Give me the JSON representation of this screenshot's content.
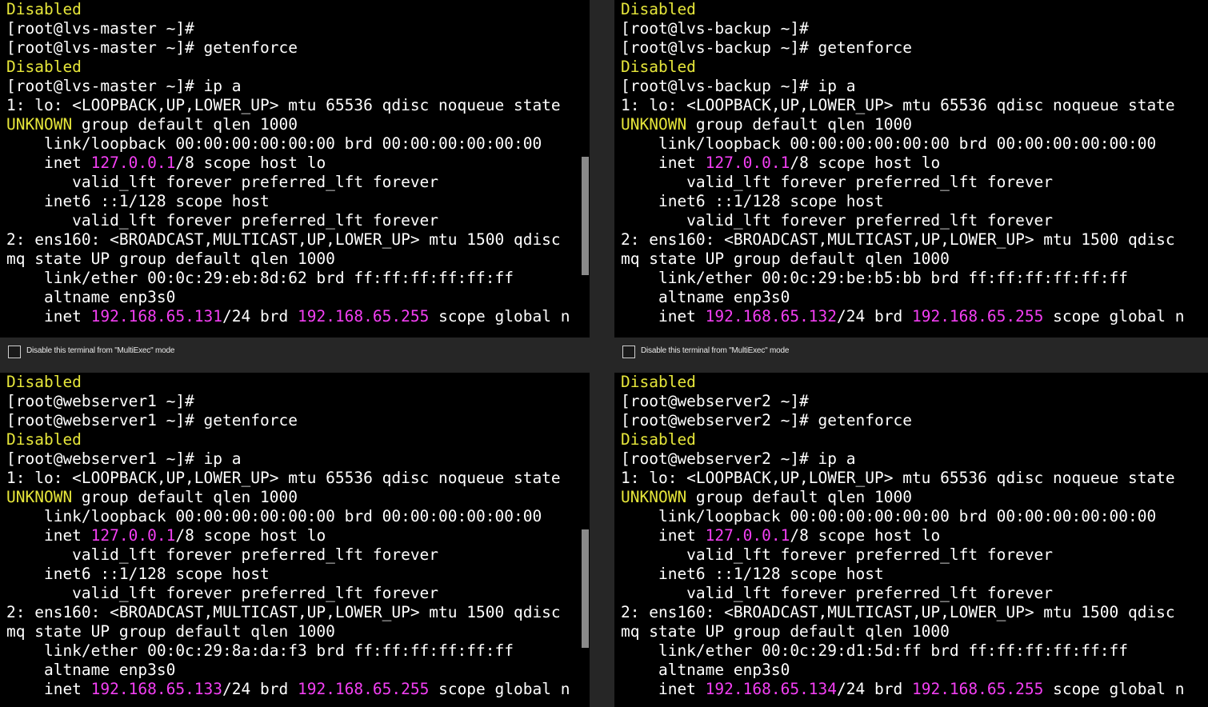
{
  "multiexec_label": "Disable this terminal from \"MultiExec\" mode",
  "colors": {
    "background": "#000000",
    "text": "#ffffff",
    "highlight_yellow": "#e6e63a",
    "highlight_magenta": "#f33ff3"
  },
  "panes": [
    {
      "lines": [
        [
          {
            "t": "Disabled",
            "c": "y"
          }
        ],
        [
          {
            "t": "[root@lvs-master ~]#"
          }
        ],
        [
          {
            "t": "[root@lvs-master ~]# getenforce"
          }
        ],
        [
          {
            "t": "Disabled",
            "c": "y"
          }
        ],
        [
          {
            "t": "[root@lvs-master ~]# ip a"
          }
        ],
        [
          {
            "t": "1: lo: <LOOPBACK,UP,LOWER_UP> mtu 65536 qdisc noqueue state"
          }
        ],
        [
          {
            "t": "UNKNOWN",
            "c": "y"
          },
          {
            "t": " group default qlen 1000"
          }
        ],
        [
          {
            "t": "    link/loopback 00:00:00:00:00:00 brd 00:00:00:00:00:00"
          }
        ],
        [
          {
            "t": "    inet "
          },
          {
            "t": "127.0.0.1",
            "c": "m"
          },
          {
            "t": "/8 scope host lo"
          }
        ],
        [
          {
            "t": "       valid_lft forever preferred_lft forever"
          }
        ],
        [
          {
            "t": "    inet6 ::1/128 scope host"
          }
        ],
        [
          {
            "t": "       valid_lft forever preferred_lft forever"
          }
        ],
        [
          {
            "t": "2: ens160: <BROADCAST,MULTICAST,UP,LOWER_UP> mtu 1500 qdisc"
          }
        ],
        [
          {
            "t": "mq state UP group default qlen 1000"
          }
        ],
        [
          {
            "t": "    link/ether 00:0c:29:eb:8d:62 brd ff:ff:ff:ff:ff:ff"
          }
        ],
        [
          {
            "t": "    altname enp3s0"
          }
        ],
        [
          {
            "t": "    inet "
          },
          {
            "t": "192.168.65.131",
            "c": "m"
          },
          {
            "t": "/24 brd "
          },
          {
            "t": "192.168.65.255",
            "c": "m"
          },
          {
            "t": " scope global n"
          }
        ]
      ]
    },
    {
      "lines": [
        [
          {
            "t": "Disabled",
            "c": "y"
          }
        ],
        [
          {
            "t": "[root@lvs-backup ~]#"
          }
        ],
        [
          {
            "t": "[root@lvs-backup ~]# getenforce"
          }
        ],
        [
          {
            "t": "Disabled",
            "c": "y"
          }
        ],
        [
          {
            "t": "[root@lvs-backup ~]# ip a"
          }
        ],
        [
          {
            "t": "1: lo: <LOOPBACK,UP,LOWER_UP> mtu 65536 qdisc noqueue state"
          }
        ],
        [
          {
            "t": "UNKNOWN",
            "c": "y"
          },
          {
            "t": " group default qlen 1000"
          }
        ],
        [
          {
            "t": "    link/loopback 00:00:00:00:00:00 brd 00:00:00:00:00:00"
          }
        ],
        [
          {
            "t": "    inet "
          },
          {
            "t": "127.0.0.1",
            "c": "m"
          },
          {
            "t": "/8 scope host lo"
          }
        ],
        [
          {
            "t": "       valid_lft forever preferred_lft forever"
          }
        ],
        [
          {
            "t": "    inet6 ::1/128 scope host"
          }
        ],
        [
          {
            "t": "       valid_lft forever preferred_lft forever"
          }
        ],
        [
          {
            "t": "2: ens160: <BROADCAST,MULTICAST,UP,LOWER_UP> mtu 1500 qdisc"
          }
        ],
        [
          {
            "t": "mq state UP group default qlen 1000"
          }
        ],
        [
          {
            "t": "    link/ether 00:0c:29:be:b5:bb brd ff:ff:ff:ff:ff:ff"
          }
        ],
        [
          {
            "t": "    altname enp3s0"
          }
        ],
        [
          {
            "t": "    inet "
          },
          {
            "t": "192.168.65.132",
            "c": "m"
          },
          {
            "t": "/24 brd "
          },
          {
            "t": "192.168.65.255",
            "c": "m"
          },
          {
            "t": " scope global n"
          }
        ]
      ]
    },
    {
      "lines": [
        [
          {
            "t": "Disabled",
            "c": "y"
          }
        ],
        [
          {
            "t": "[root@webserver1 ~]#"
          }
        ],
        [
          {
            "t": "[root@webserver1 ~]# getenforce"
          }
        ],
        [
          {
            "t": "Disabled",
            "c": "y"
          }
        ],
        [
          {
            "t": "[root@webserver1 ~]# ip a"
          }
        ],
        [
          {
            "t": "1: lo: <LOOPBACK,UP,LOWER_UP> mtu 65536 qdisc noqueue state"
          }
        ],
        [
          {
            "t": "UNKNOWN",
            "c": "y"
          },
          {
            "t": " group default qlen 1000"
          }
        ],
        [
          {
            "t": "    link/loopback 00:00:00:00:00:00 brd 00:00:00:00:00:00"
          }
        ],
        [
          {
            "t": "    inet "
          },
          {
            "t": "127.0.0.1",
            "c": "m"
          },
          {
            "t": "/8 scope host lo"
          }
        ],
        [
          {
            "t": "       valid_lft forever preferred_lft forever"
          }
        ],
        [
          {
            "t": "    inet6 ::1/128 scope host"
          }
        ],
        [
          {
            "t": "       valid_lft forever preferred_lft forever"
          }
        ],
        [
          {
            "t": "2: ens160: <BROADCAST,MULTICAST,UP,LOWER_UP> mtu 1500 qdisc"
          }
        ],
        [
          {
            "t": "mq state UP group default qlen 1000"
          }
        ],
        [
          {
            "t": "    link/ether 00:0c:29:8a:da:f3 brd ff:ff:ff:ff:ff:ff"
          }
        ],
        [
          {
            "t": "    altname enp3s0"
          }
        ],
        [
          {
            "t": "    inet "
          },
          {
            "t": "192.168.65.133",
            "c": "m"
          },
          {
            "t": "/24 brd "
          },
          {
            "t": "192.168.65.255",
            "c": "m"
          },
          {
            "t": " scope global n"
          }
        ]
      ]
    },
    {
      "lines": [
        [
          {
            "t": "Disabled",
            "c": "y"
          }
        ],
        [
          {
            "t": "[root@webserver2 ~]#"
          }
        ],
        [
          {
            "t": "[root@webserver2 ~]# getenforce"
          }
        ],
        [
          {
            "t": "Disabled",
            "c": "y"
          }
        ],
        [
          {
            "t": "[root@webserver2 ~]# ip a"
          }
        ],
        [
          {
            "t": "1: lo: <LOOPBACK,UP,LOWER_UP> mtu 65536 qdisc noqueue state"
          }
        ],
        [
          {
            "t": "UNKNOWN",
            "c": "y"
          },
          {
            "t": " group default qlen 1000"
          }
        ],
        [
          {
            "t": "    link/loopback 00:00:00:00:00:00 brd 00:00:00:00:00:00"
          }
        ],
        [
          {
            "t": "    inet "
          },
          {
            "t": "127.0.0.1",
            "c": "m"
          },
          {
            "t": "/8 scope host lo"
          }
        ],
        [
          {
            "t": "       valid_lft forever preferred_lft forever"
          }
        ],
        [
          {
            "t": "    inet6 ::1/128 scope host"
          }
        ],
        [
          {
            "t": "       valid_lft forever preferred_lft forever"
          }
        ],
        [
          {
            "t": "2: ens160: <BROADCAST,MULTICAST,UP,LOWER_UP> mtu 1500 qdisc"
          }
        ],
        [
          {
            "t": "mq state UP group default qlen 1000"
          }
        ],
        [
          {
            "t": "    link/ether 00:0c:29:d1:5d:ff brd ff:ff:ff:ff:ff:ff"
          }
        ],
        [
          {
            "t": "    altname enp3s0"
          }
        ],
        [
          {
            "t": "    inet "
          },
          {
            "t": "192.168.65.134",
            "c": "m"
          },
          {
            "t": "/24 brd "
          },
          {
            "t": "192.168.65.255",
            "c": "m"
          },
          {
            "t": " scope global n"
          }
        ]
      ]
    }
  ]
}
